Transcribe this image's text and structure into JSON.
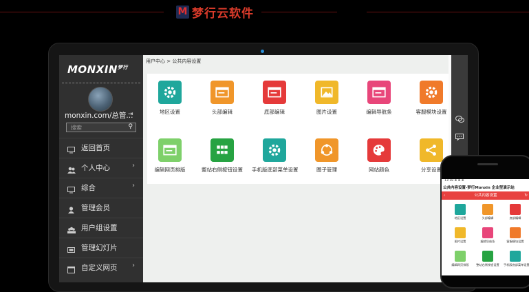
{
  "banner": {
    "brand_mark": "M",
    "brand_text": "梦行云软件"
  },
  "sidebar": {
    "logo": "MONXIN",
    "logo_sub": "梦行",
    "username": "monxin.com/总管...",
    "search_placeholder": "搜索",
    "items": [
      {
        "label": "返回首页",
        "icon": "monitor-icon",
        "arrow": ""
      },
      {
        "label": "个人中心",
        "icon": "users-icon",
        "arrow": "›"
      },
      {
        "label": "综合",
        "icon": "monitor-icon",
        "arrow": "›"
      },
      {
        "label": "管理会员",
        "icon": "user-icon",
        "arrow": ""
      },
      {
        "label": "用户组设置",
        "icon": "group-icon",
        "arrow": ""
      },
      {
        "label": "管理幻灯片",
        "icon": "slides-icon",
        "arrow": ""
      },
      {
        "label": "自定义网页",
        "icon": "page-icon",
        "arrow": "›"
      }
    ]
  },
  "breadcrumb": "用户中心 > 公共内容设置",
  "tiles": [
    {
      "label": "地区设置",
      "color": "#1fa79c",
      "icon": "gear-icon"
    },
    {
      "label": "头部编辑",
      "color": "#f0962a",
      "icon": "browser-icon"
    },
    {
      "label": "底部编辑",
      "color": "#e53a3a",
      "icon": "browser-icon"
    },
    {
      "label": "图片设置",
      "color": "#f0b82a",
      "icon": "image-icon"
    },
    {
      "label": "编辑导航条",
      "color": "#e8467a",
      "icon": "browser-icon"
    },
    {
      "label": "客服模块设置",
      "color": "#f07a2a",
      "icon": "gear-icon"
    },
    {
      "label": "编辑网页排版",
      "color": "#7ed06a",
      "icon": "browser-icon"
    },
    {
      "label": "整站右侧按钮设置",
      "color": "#27a342",
      "icon": "grid-icon"
    },
    {
      "label": "手机版底部菜单设置",
      "color": "#1fa79c",
      "icon": "gear-icon"
    },
    {
      "label": "圈子管理",
      "color": "#f0962a",
      "icon": "circle-icon"
    },
    {
      "label": "网站颜色",
      "color": "#e53a3a",
      "icon": "palette-icon"
    },
    {
      "label": "分享设置",
      "color": "#f0b82a",
      "icon": "share-icon"
    }
  ],
  "right_icons": [
    "wechat-icon",
    "message-icon"
  ],
  "phone": {
    "status": "13:18 ⊕ ⊕ ⊕",
    "title": "公共内容设置-梦行Monxin 企业型演示站",
    "header": "公共内容设置",
    "tiles": [
      {
        "label": "地区设置",
        "color": "#1fa79c"
      },
      {
        "label": "头部编辑",
        "color": "#f0962a"
      },
      {
        "label": "底部编辑",
        "color": "#e53a3a"
      },
      {
        "label": "图片设置",
        "color": "#f0b82a"
      },
      {
        "label": "编辑导航条",
        "color": "#e8467a"
      },
      {
        "label": "客服模块设置",
        "color": "#f07a2a"
      },
      {
        "label": "编辑网页排版",
        "color": "#7ed06a"
      },
      {
        "label": "整站右侧按钮设置",
        "color": "#27a342"
      },
      {
        "label": "手机版底部菜单设置",
        "color": "#1fa79c"
      }
    ]
  }
}
